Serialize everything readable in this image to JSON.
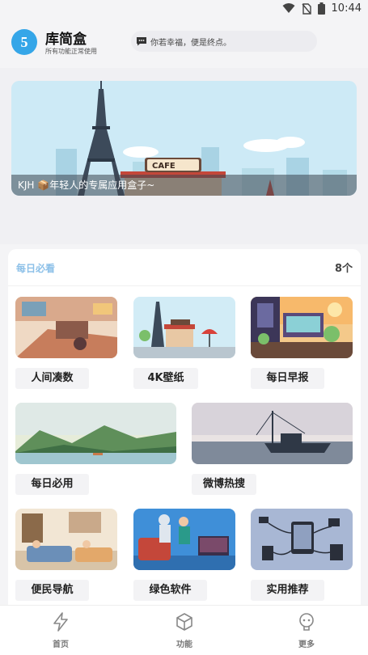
{
  "status_bar": {
    "time": "10:44",
    "icons": [
      "wifi-icon",
      "no-sim-icon",
      "battery-icon"
    ]
  },
  "header": {
    "logo_glyph": "5",
    "title": "库简盒",
    "subtitle": "所有功能正常使用",
    "quote": "你若幸福，便是终点。",
    "accent": "#35a6e8"
  },
  "banner": {
    "caption": "KJH 📦年轻人的专属应用盒子~",
    "sign_text": "CAFE"
  },
  "daily": {
    "title": "每日必看",
    "count": "8个",
    "items": [
      {
        "label": "人间凑数",
        "icon": "room-illustration"
      },
      {
        "label": "4K壁纸",
        "icon": "cafe-illustration"
      },
      {
        "label": "每日早报",
        "icon": "balcony-illustration"
      },
      {
        "label": "每日必用",
        "icon": "lake-illustration"
      },
      {
        "label": "微博热搜",
        "icon": "boat-illustration"
      },
      {
        "label": "便民导航",
        "icon": "sofa-illustration"
      },
      {
        "label": "绿色软件",
        "icon": "robot-illustration"
      },
      {
        "label": "实用推荐",
        "icon": "gadgets-illustration"
      }
    ]
  },
  "nav": {
    "items": [
      {
        "label": "首页",
        "icon": "lightning-icon"
      },
      {
        "label": "功能",
        "icon": "cube-icon"
      },
      {
        "label": "更多",
        "icon": "robot-face-icon"
      }
    ]
  }
}
